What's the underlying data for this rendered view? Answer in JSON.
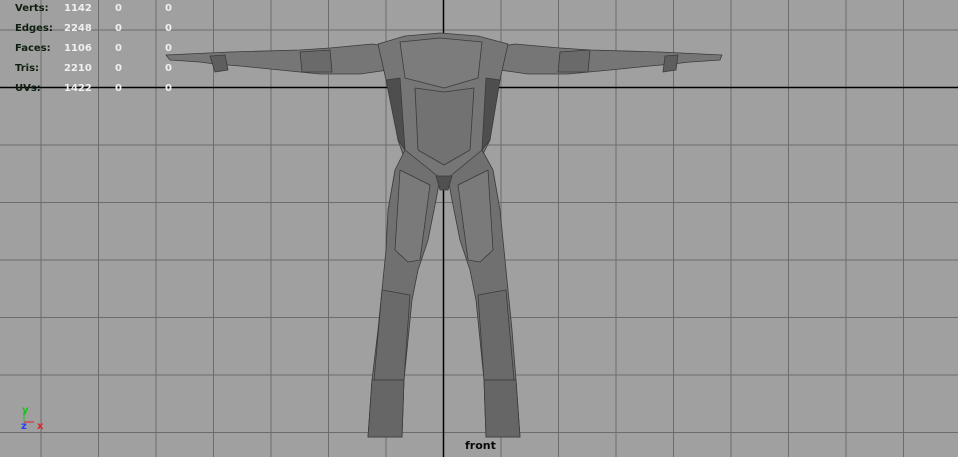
{
  "viewport": {
    "camera_name": "front",
    "background_color": "#a0a0a0",
    "grid_color": "#6c6c6c",
    "axis_color": "#000000",
    "model_color": "#6e6e6e"
  },
  "hud": {
    "rows": [
      {
        "label": "Verts:",
        "values": [
          "1142",
          "0",
          "0"
        ]
      },
      {
        "label": "Edges:",
        "values": [
          "2248",
          "0",
          "0"
        ]
      },
      {
        "label": "Faces:",
        "values": [
          "1106",
          "0",
          "0"
        ]
      },
      {
        "label": "Tris:",
        "values": [
          "2210",
          "0",
          "0"
        ]
      },
      {
        "label": "UVs:",
        "values": [
          "1422",
          "0",
          "0"
        ]
      }
    ]
  },
  "axis_gizmo": {
    "y_label": "y",
    "z_label": "z",
    "x_label": "x",
    "y_color": "#20c020",
    "z_color": "#2040ff",
    "x_color": "#e02020"
  }
}
